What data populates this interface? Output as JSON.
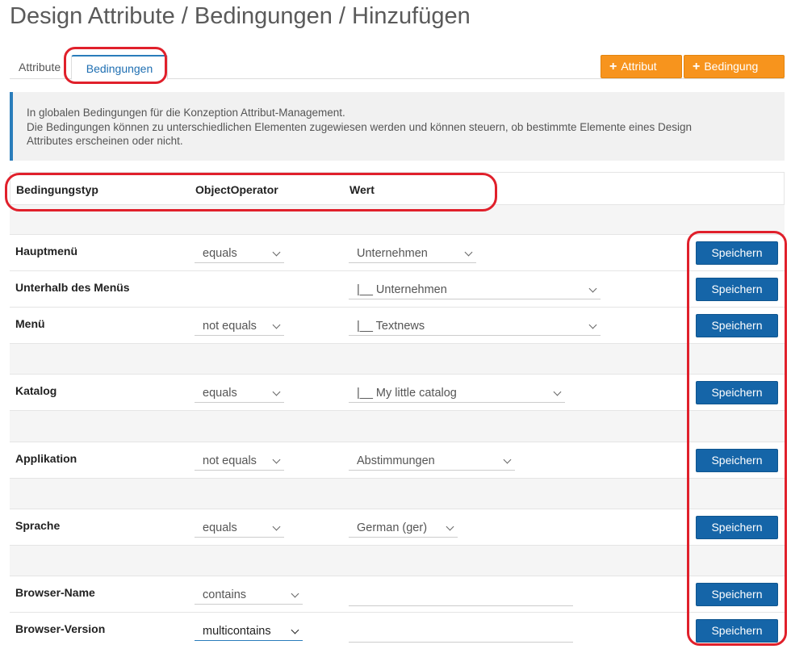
{
  "page": {
    "title": "Design Attribute / Bedingungen / Hinzufügen"
  },
  "tabs": {
    "attribute": "Attribute",
    "bedingungen": "Bedingungen"
  },
  "toolbar": {
    "add_attribut": "Attribut",
    "add_bedingung": "Bedingung"
  },
  "info": {
    "line1": "In globalen Bedingungen für die Konzeption Attribut-Management.",
    "line2": "Die Bedingungen können zu unterschiedlichen Elementen zugewiesen werden und können steuern, ob bestimmte Elemente eines Design",
    "line3": "Attributes erscheinen oder nicht."
  },
  "table": {
    "headers": {
      "type": "Bedingungstyp",
      "operator": "ObjectOperator",
      "value": "Wert"
    },
    "save_label": "Speichern",
    "rows": {
      "hauptmenu": {
        "label": "Hauptmenü",
        "operator": "equals",
        "value": "Unternehmen"
      },
      "unterhalb": {
        "label": "Unterhalb des Menüs",
        "value": "|__ Unternehmen"
      },
      "menu": {
        "label": "Menü",
        "operator": "not equals",
        "value": "|__ Textnews"
      },
      "katalog": {
        "label": "Katalog",
        "operator": "equals",
        "value": "|__ My little catalog"
      },
      "applikation": {
        "label": "Applikation",
        "operator": "not equals",
        "value": "Abstimmungen"
      },
      "sprache": {
        "label": "Sprache",
        "operator": "equals",
        "value": "German (ger)"
      },
      "browser_name": {
        "label": "Browser-Name",
        "operator": "contains",
        "value": ""
      },
      "browser_version": {
        "label": "Browser-Version",
        "operator": "multicontains",
        "value": ""
      }
    }
  },
  "colors": {
    "accent": "#f7941d",
    "primary": "#1565a8",
    "highlight": "#e0202b",
    "info_border": "#2a7dbb"
  }
}
